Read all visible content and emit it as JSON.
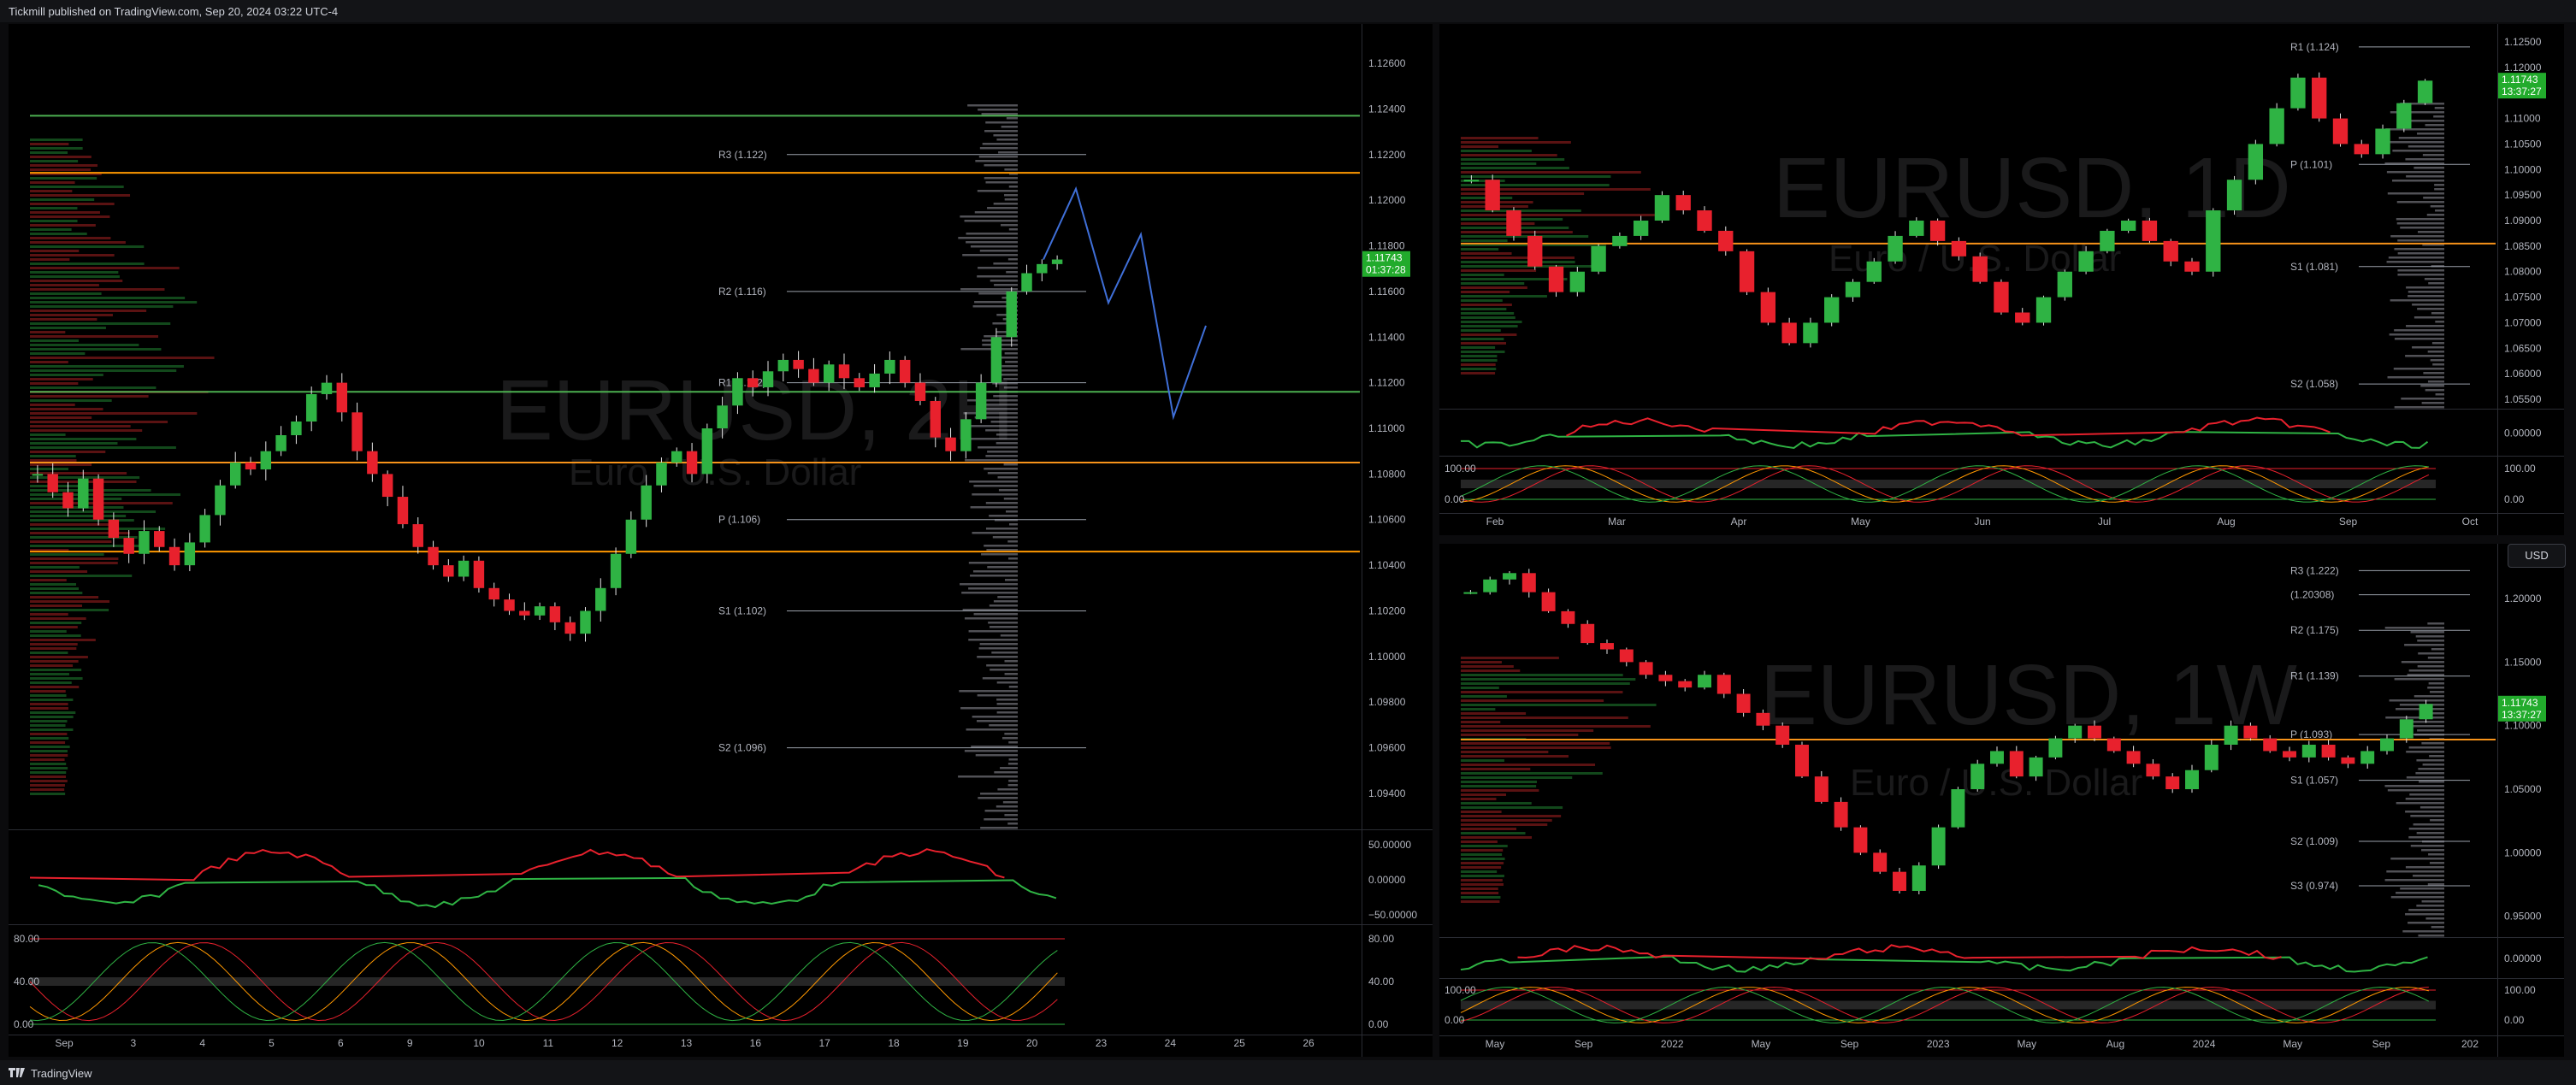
{
  "header": {
    "published_text": "Tickmill published on TradingView.com, Sep 20, 2024 03:22 UTC-4"
  },
  "footer": {
    "brand": "TradingView"
  },
  "currency_button": "USD",
  "chart_data": [
    {
      "type": "candlestick",
      "title": "EURUSD, 2H",
      "subtitle": "Euro / U.S. Dollar",
      "timeframe": "2H",
      "price_ticks": [
        "1.12600",
        "1.12400",
        "1.12200",
        "1.12000",
        "1.11800",
        "1.11600",
        "1.11400",
        "1.11200",
        "1.11000",
        "1.10800",
        "1.10600",
        "1.10400",
        "1.10200",
        "1.10000",
        "1.09800",
        "1.09600",
        "1.09400"
      ],
      "ylim": [
        1.0925,
        1.1272
      ],
      "x_ticks": [
        "Sep",
        "3",
        "4",
        "5",
        "6",
        "9",
        "10",
        "11",
        "12",
        "13",
        "16",
        "17",
        "18",
        "19",
        "20",
        "23",
        "24",
        "25",
        "26"
      ],
      "last_price": {
        "value": "1.11743",
        "countdown": "01:37:28"
      },
      "pivot_levels": [
        {
          "label": "R3 (1.122)",
          "value": 1.122
        },
        {
          "label": "R2 (1.116)",
          "value": 1.116
        },
        {
          "label": "R1 (1.112)",
          "value": 1.112
        },
        {
          "label": "P (1.106)",
          "value": 1.106
        },
        {
          "label": "S1 (1.102)",
          "value": 1.102
        },
        {
          "label": "S2 (1.096)",
          "value": 1.096
        }
      ],
      "key_levels": [
        {
          "value": 1.1085,
          "color": "#f7931a"
        },
        {
          "value": 1.1212,
          "color": "#ff9800"
        },
        {
          "value": 1.1046,
          "color": "#ff9800"
        },
        {
          "value": 1.1237,
          "color": "#4caf50"
        },
        {
          "value": 1.1116,
          "color": "#4caf50"
        }
      ],
      "close_path": [
        1.108,
        1.1072,
        1.1065,
        1.1078,
        1.106,
        1.1052,
        1.1045,
        1.1055,
        1.1048,
        1.104,
        1.105,
        1.1062,
        1.1075,
        1.1085,
        1.1082,
        1.109,
        1.1097,
        1.1103,
        1.1115,
        1.112,
        1.1107,
        1.109,
        1.108,
        1.107,
        1.1058,
        1.1048,
        1.104,
        1.1035,
        1.1042,
        1.103,
        1.1025,
        1.102,
        1.1018,
        1.1022,
        1.1015,
        1.101,
        1.102,
        1.103,
        1.1045,
        1.106,
        1.1075,
        1.1085,
        1.109,
        1.108,
        1.11,
        1.111,
        1.1122,
        1.1118,
        1.1125,
        1.113,
        1.1126,
        1.112,
        1.1128,
        1.1122,
        1.1118,
        1.1124,
        1.113,
        1.112,
        1.1112,
        1.1096,
        1.109,
        1.1104,
        1.112,
        1.114,
        1.116,
        1.1168,
        1.1172,
        1.1174
      ],
      "projection": [
        [
          1.1174,
          0
        ],
        [
          1.1205,
          1
        ],
        [
          1.1155,
          2
        ],
        [
          1.1185,
          3
        ],
        [
          1.1105,
          4
        ],
        [
          1.1145,
          5
        ]
      ],
      "oscillator1": {
        "ticks": [
          "50.00000",
          "0.00000",
          "−50.00000"
        ]
      },
      "oscillator2": {
        "ticks": [
          "80.00",
          "40.00",
          "0.00"
        ],
        "right_ticks": [
          "80.00",
          "40.00",
          "0.00"
        ]
      }
    },
    {
      "type": "candlestick",
      "title": "EURUSD, 1D",
      "subtitle": "Euro / U.S. Dollar",
      "timeframe": "1D",
      "price_ticks": [
        "1.12500",
        "1.12000",
        "1.11500",
        "1.11000",
        "1.10500",
        "1.10000",
        "1.09500",
        "1.09000",
        "1.08500",
        "1.08000",
        "1.07500",
        "1.07000",
        "1.06500",
        "1.06000",
        "1.05500"
      ],
      "ylim": [
        1.0535,
        1.1265
      ],
      "x_ticks": [
        "Feb",
        "Mar",
        "Apr",
        "May",
        "Jun",
        "Jul",
        "Aug",
        "Sep",
        "Oct"
      ],
      "last_price": {
        "value": "1.11743",
        "countdown": "13:37:27"
      },
      "pivot_levels": [
        {
          "label": "R1 (1.124)",
          "value": 1.124
        },
        {
          "label": "P (1.101)",
          "value": 1.101
        },
        {
          "label": "S1 (1.081)",
          "value": 1.081
        },
        {
          "label": "S2 (1.058)",
          "value": 1.058
        }
      ],
      "key_levels": [
        {
          "value": 1.0855,
          "color": "#f7931a"
        }
      ],
      "close_path": [
        1.098,
        1.092,
        1.087,
        1.081,
        1.076,
        1.08,
        1.085,
        1.087,
        1.09,
        1.095,
        1.092,
        1.088,
        1.084,
        1.076,
        1.07,
        1.066,
        1.07,
        1.075,
        1.078,
        1.082,
        1.087,
        1.09,
        1.086,
        1.083,
        1.078,
        1.072,
        1.07,
        1.075,
        1.08,
        1.084,
        1.088,
        1.09,
        1.086,
        1.082,
        1.08,
        1.092,
        1.098,
        1.105,
        1.112,
        1.118,
        1.11,
        1.105,
        1.103,
        1.108,
        1.113,
        1.1174
      ],
      "oscillator1": {
        "ticks": [
          "0.00000"
        ]
      },
      "oscillator2": {
        "ticks": [
          "100.00",
          "0.00"
        ],
        "right_ticks": [
          "100.00",
          "0.00"
        ]
      }
    },
    {
      "type": "candlestick",
      "title": "EURUSD, 1W",
      "subtitle": "Euro / U.S. Dollar",
      "timeframe": "1W",
      "price_ticks": [
        "1.20000",
        "1.15000",
        "1.10000",
        "1.05000",
        "1.00000",
        "0.95000"
      ],
      "ylim": [
        0.935,
        1.235
      ],
      "x_ticks": [
        "May",
        "Sep",
        "2022",
        "May",
        "Sep",
        "2023",
        "May",
        "Aug",
        "2024",
        "May",
        "Sep",
        "202"
      ],
      "last_price": {
        "value": "1.11743",
        "countdown": "13:37:27"
      },
      "pivot_levels": [
        {
          "label": "R3 (1.222)",
          "value": 1.222
        },
        {
          "label": "R2 (1.175)",
          "value": 1.175
        },
        {
          "label": "R1 (1.139)",
          "value": 1.139
        },
        {
          "label": "P (1.093)",
          "value": 1.093
        },
        {
          "label": "S1 (1.057)",
          "value": 1.057
        },
        {
          "label": "S2 (1.009)",
          "value": 1.009
        },
        {
          "label": "S3 (0.974)",
          "value": 0.974
        },
        {
          "label": "(1.20308)",
          "value": 1.203
        }
      ],
      "key_levels": [
        {
          "value": 1.089,
          "color": "#f7931a"
        }
      ],
      "close_path": [
        1.205,
        1.215,
        1.22,
        1.205,
        1.19,
        1.18,
        1.165,
        1.16,
        1.15,
        1.14,
        1.135,
        1.13,
        1.14,
        1.125,
        1.11,
        1.1,
        1.085,
        1.06,
        1.04,
        1.02,
        1.0,
        0.985,
        0.97,
        0.99,
        1.02,
        1.05,
        1.07,
        1.08,
        1.06,
        1.075,
        1.09,
        1.1,
        1.09,
        1.08,
        1.07,
        1.06,
        1.05,
        1.065,
        1.085,
        1.1,
        1.09,
        1.08,
        1.075,
        1.085,
        1.075,
        1.07,
        1.08,
        1.09,
        1.105,
        1.117
      ],
      "oscillator1": {
        "ticks": [
          "0.00000"
        ]
      },
      "oscillator2": {
        "ticks": [
          "100.00",
          "0.00"
        ],
        "right_ticks": [
          "100.00",
          "0.00"
        ]
      }
    }
  ]
}
